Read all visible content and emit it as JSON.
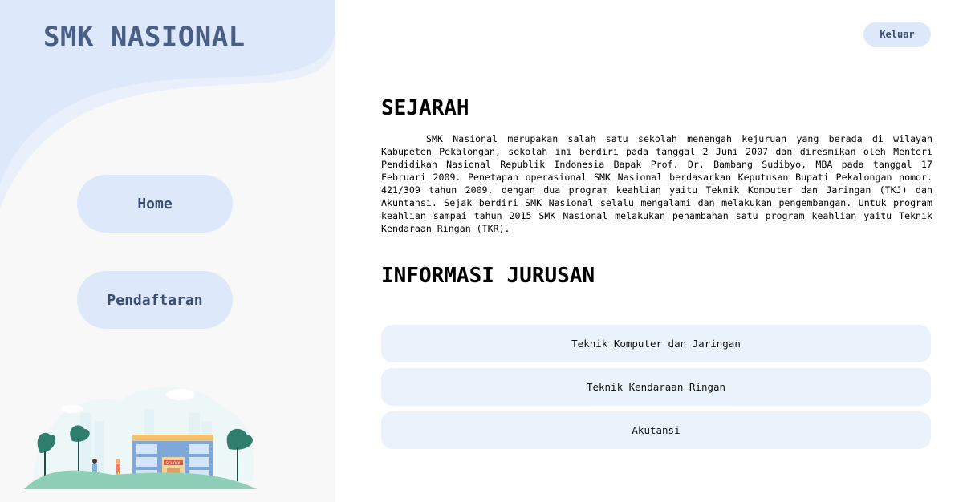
{
  "sidebar": {
    "brand": "SMK NASIONAL",
    "nav": [
      {
        "label": "Home"
      },
      {
        "label": "Pendaftaran"
      }
    ],
    "illustration": {
      "sign_text": "SCHOOL",
      "colors": {
        "tree": "#2f7d6d",
        "building": "#7fa7d9",
        "roof": "#f5c26b",
        "grass": "#8fcfb8"
      }
    }
  },
  "header": {
    "logout_label": "Keluar"
  },
  "main": {
    "history_title": "SEJARAH",
    "history_text": "SMK Nasional merupakan salah satu sekolah menengah kejuruan yang berada di wilayah Kabupeten Pekalongan, sekolah ini berdiri pada tanggal 2 Juni 2007 dan diresmikan oleh Menteri Pendidikan Nasional Republik Indonesia Bapak Prof. Dr. Bambang Sudibyo, MBA pada tanggal 17 Februari 2009. Penetapan operasional SMK Nasional berdasarkan Keputusan Bupati Pekalongan nomor. 421/309 tahun 2009, dengan dua program keahlian yaitu Teknik Komputer dan Jaringan (TKJ) dan Akuntansi. Sejak berdiri SMK Nasional selalu mengalami dan melakukan pengembangan. Untuk program keahlian sampai tahun 2015 SMK Nasional melakukan penambahan satu program keahlian yaitu Teknik Kendaraan Ringan (TKR).",
    "majors_title": "INFORMASI JURUSAN",
    "majors": [
      {
        "label": "Teknik Komputer dan Jaringan"
      },
      {
        "label": "Teknik Kendaraan Ringan"
      },
      {
        "label": "Akutansi"
      }
    ]
  },
  "colors": {
    "sidebar_bg": "#f8f8f8",
    "accent_light": "#dde9fa",
    "brand_text": "#4a5f86",
    "major_bg": "#eaf2fc"
  }
}
